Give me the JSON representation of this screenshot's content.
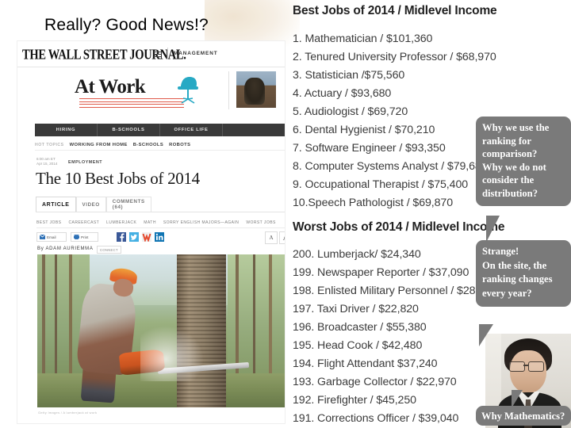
{
  "slide": {
    "headline": "Really?  Good News!?"
  },
  "wsj": {
    "logo": "THE WALL STREET JOURNAL.",
    "section": "MANAGEMENT",
    "blog_logo": "At Work",
    "nav": [
      "HIRING",
      "B-SCHOOLS",
      "OFFICE LIFE",
      ""
    ],
    "hot_topics_label": "HOT TOPICS",
    "hot_topics": [
      "WORKING FROM HOME",
      "B-SCHOOLS",
      "ROBOTS"
    ],
    "timestamp": "6:00 am ET",
    "date": "Apr 15, 2014",
    "category": "EMPLOYMENT",
    "article_title": "The 10 Best Jobs of 2014",
    "tabs": [
      "ARTICLE",
      "VIDEO",
      "COMMENTS (64)"
    ],
    "keywords": [
      "BEST JOBS",
      "CAREERCAST",
      "LUMBERJACK",
      "MATH",
      "SORRY ENGLISH MAJORS—AGAIN",
      "WORST JOBS"
    ],
    "email_label": "Email",
    "print_label": "Print",
    "text_size_small": "A",
    "text_size_large": "A",
    "byline": "By ADAM AURIEMMA",
    "connect_label": "CONNECT",
    "photo_caption": "Getty Images / A lumberjack at work"
  },
  "best_jobs": {
    "heading": "Best Jobs of 2014 / Midlevel Income",
    "items": [
      "1. Mathematician / $101,360",
      "2. Tenured University Professor / $68,970",
      "3. Statistician /$75,560",
      "4. Actuary / $93,680",
      "5. Audiologist / $69,720",
      "6. Dental Hygienist / $70,210",
      "7. Software Engineer / $93,350",
      "8. Computer Systems Analyst / $79,680",
      "9. Occupational Therapist / $75,400",
      "10.Speech Pathologist / $69,870"
    ]
  },
  "worst_jobs": {
    "heading": "Worst Jobs of 2014 / Midlevel Income",
    "items": [
      "200. Lumberjack/ $24,340",
      "199. Newspaper Reporter / $37,090",
      "198. Enlisted Military Personnel / $28,840",
      "197. Taxi Driver / $22,820",
      "196. Broadcaster / $55,380",
      "195. Head Cook / $42,480",
      "194. Flight Attendant $37,240",
      "193. Garbage Collector / $22,970",
      "192. Firefighter / $45,250",
      "191. Corrections Officer / $39,040"
    ]
  },
  "callouts": [
    {
      "id": "why-ranking",
      "lines": [
        "Why we use the",
        "ranking for",
        "comparison?",
        "Why we do not",
        "consider the",
        "distribution?"
      ]
    },
    {
      "id": "ranking-changes",
      "lines": [
        "Strange!",
        "On the site, the",
        "ranking changes",
        "every year?"
      ]
    },
    {
      "id": "why-mathematics",
      "lines": [
        "Why Mathematics?"
      ]
    }
  ],
  "colors": {
    "bubble": "#7a7a7a",
    "bubble_text": "#ffffff",
    "wsj_nav": "#3a3a3a",
    "accent_red": "#e05a4a"
  }
}
